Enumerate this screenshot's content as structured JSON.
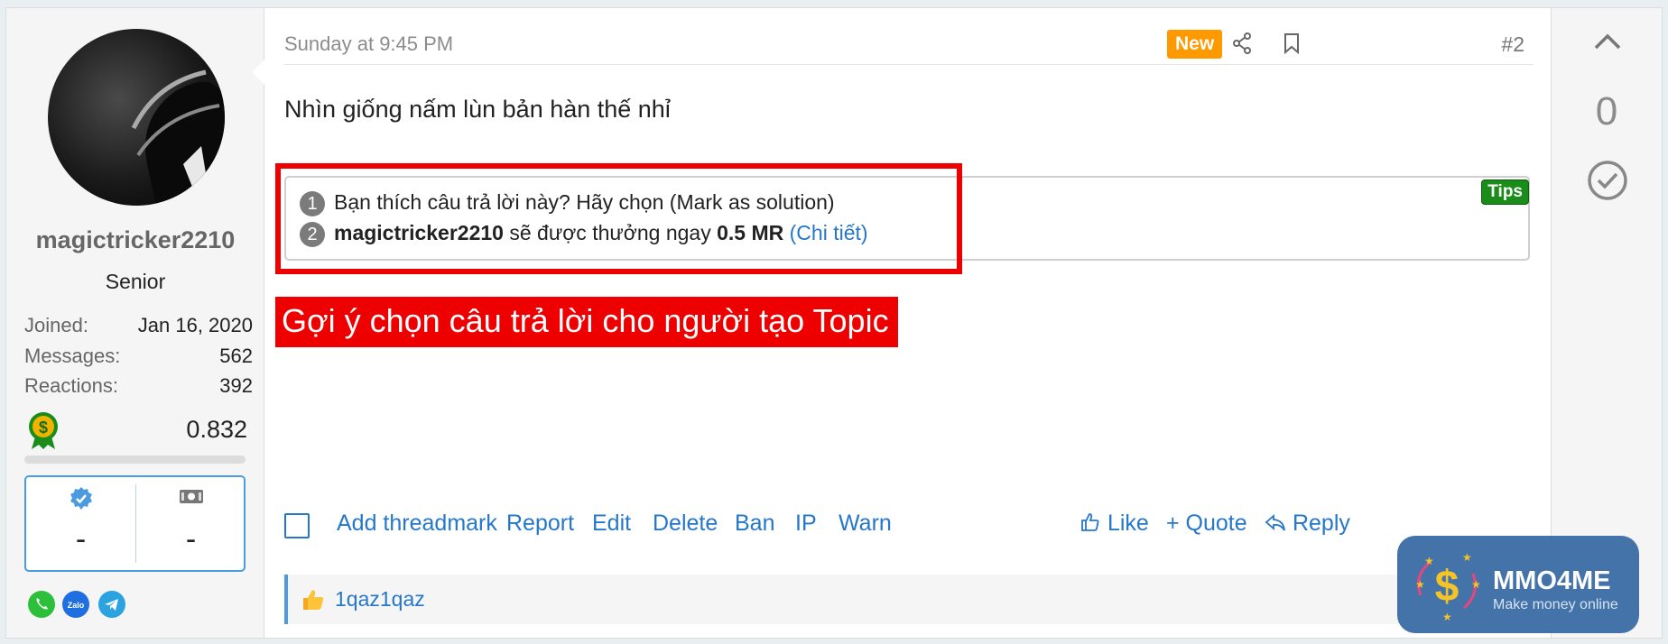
{
  "user": {
    "username": "magictricker2210",
    "title": "Senior",
    "stats": [
      {
        "label": "Joined:",
        "value": "Jan 16, 2020"
      },
      {
        "label": "Messages:",
        "value": "562"
      },
      {
        "label": "Reactions:",
        "value": "392"
      }
    ],
    "balance": "0.832",
    "mini_stats": [
      "-",
      "-"
    ]
  },
  "post": {
    "date": "Sunday at 9:45 PM",
    "new_badge": "New",
    "number": "#2",
    "message": "Nhìn giống nấm lùn bản hàn thế nhỉ",
    "tips": {
      "badge": "Tips",
      "line1_num": "1",
      "line1": "Bạn thích câu trả lời này? Hãy chọn (Mark as solution)",
      "line2_num": "2",
      "line2_user": "magictricker2210",
      "line2_mid": " sẽ được thưởng ngay ",
      "line2_reward": "0.5 MR",
      "line2_link": "(Chi tiết)"
    },
    "annotation": "Gợi ý chọn câu trả lời cho người tạo Topic",
    "actions": {
      "add_threadmark": "Add threadmark",
      "report": "Report",
      "edit": "Edit",
      "delete": "Delete",
      "ban": "Ban",
      "ip": "IP",
      "warn": "Warn",
      "like": "Like",
      "quote": "+ Quote",
      "reply": "Reply"
    },
    "reactions": {
      "user": "1qaz1qaz"
    }
  },
  "vote": {
    "score": "0"
  },
  "logo": {
    "name": "MMO4ME",
    "tagline": "Make money online"
  },
  "colors": {
    "accent": "#2577c9",
    "new": "#ff9900",
    "annotation": "#ee0000",
    "tips": "#1a8c1a"
  }
}
